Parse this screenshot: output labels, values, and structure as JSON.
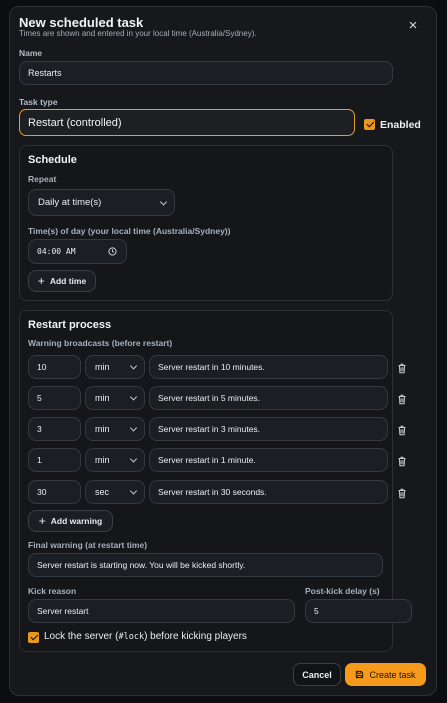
{
  "dialog": {
    "title": "New scheduled task",
    "subtitle": "Times are shown and entered in your local time (Australia/Sydney).",
    "close_icon": "×"
  },
  "name": {
    "label": "Name",
    "value": "Restarts"
  },
  "task_type": {
    "label": "Task type",
    "value": "Restart (controlled)"
  },
  "enabled": {
    "label": "Enabled",
    "checked": true
  },
  "schedule": {
    "title": "Schedule",
    "repeat_label": "Repeat",
    "repeat_value": "Daily at time(s)",
    "time_label": "Time(s) of day (your local time (Australia/Sydney))",
    "time_value": "04:00 AM",
    "add_time_label": "Add time"
  },
  "restart": {
    "title": "Restart process",
    "warnings_label": "Warning broadcasts (before restart)",
    "warnings": [
      {
        "amount": "10",
        "unit": "min",
        "message": "Server restart in 10 minutes."
      },
      {
        "amount": "5",
        "unit": "min",
        "message": "Server restart in 5 minutes."
      },
      {
        "amount": "3",
        "unit": "min",
        "message": "Server restart in 3 minutes."
      },
      {
        "amount": "1",
        "unit": "min",
        "message": "Server restart in 1 minute."
      },
      {
        "amount": "30",
        "unit": "sec",
        "message": "Server restart in 30 seconds."
      }
    ],
    "add_warning_label": "Add warning",
    "final_warning_label": "Final warning (at restart time)",
    "final_warning_value": "Server restart is starting now. You will be kicked shortly.",
    "kick_reason_label": "Kick reason",
    "kick_reason_value": "Server restart",
    "post_kick_label": "Post-kick delay (s)",
    "post_kick_value": "5",
    "lock_label_pre": "Lock the server (",
    "lock_code": "#lock",
    "lock_label_post": ") before kicking players",
    "lock_checked": true
  },
  "footer": {
    "cancel_label": "Cancel",
    "create_label": "Create task"
  },
  "colors": {
    "accent": "#f59a1b",
    "panel": "#14161a",
    "background": "#16181c"
  }
}
